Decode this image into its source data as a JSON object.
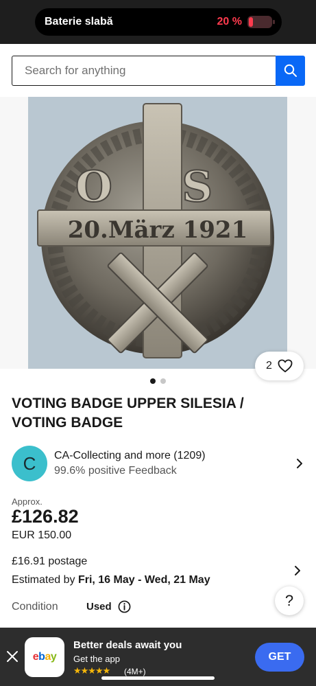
{
  "status": {
    "battery_label": "Baterie slabă",
    "battery_percent": "20 %",
    "battery_level": 0.2
  },
  "search": {
    "placeholder": "Search for anything"
  },
  "gallery": {
    "watch_count": "2",
    "image_count": 2,
    "current_image": 1
  },
  "listing": {
    "title": "VOTING BADGE UPPER SILESIA / VOTING BADGE",
    "image_text": {
      "letters": "O S",
      "date": "20.März 1921"
    }
  },
  "seller": {
    "initial": "C",
    "name": "CA-Collecting and more (1209)",
    "feedback": "99.6% positive Feedback"
  },
  "price": {
    "approx_label": "Approx.",
    "gbp": "£126.82",
    "eur": "EUR 150.00"
  },
  "postage": {
    "cost": "£16.91 postage",
    "estimated_prefix": "Estimated by",
    "estimated_dates": "Fri, 16 May - Wed, 21 May"
  },
  "condition": {
    "label": "Condition",
    "value": "Used"
  },
  "help": {
    "label": "?"
  },
  "app_banner": {
    "logo_text": "ebay",
    "title": "Better deals await you",
    "subtitle": "Get the app",
    "stars": "★★★★★",
    "rating_count": "(4M+)",
    "button": "GET"
  },
  "colors": {
    "accent_blue": "#0968f6",
    "get_blue": "#3a6bf0",
    "avatar_teal": "#3bbfcc",
    "battery_red": "#ff3b4e",
    "star_gold": "#f5b60a"
  }
}
